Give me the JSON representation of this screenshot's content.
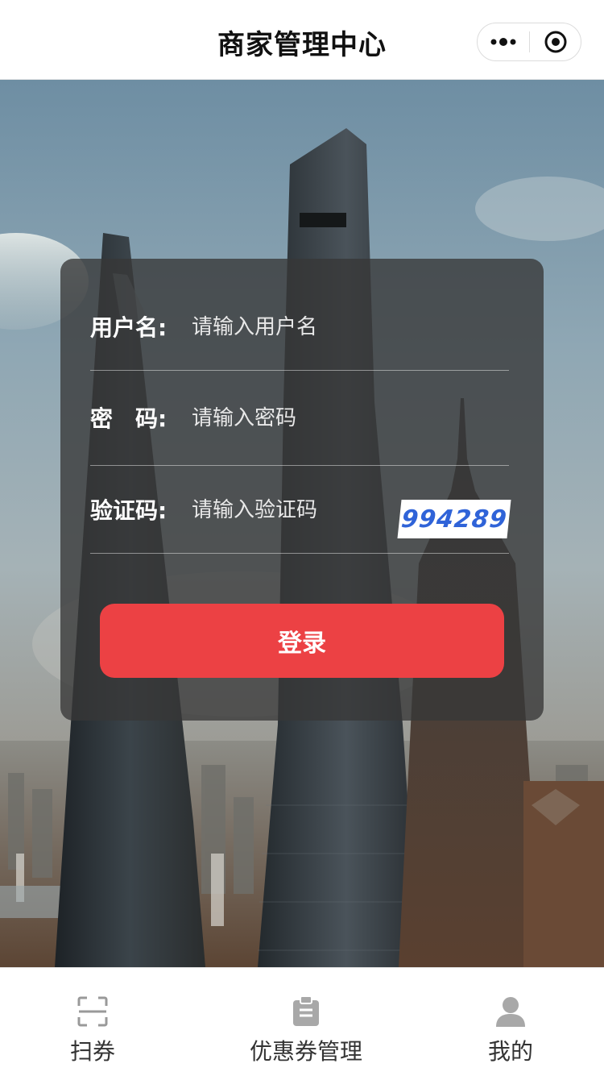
{
  "header": {
    "title": "商家管理中心"
  },
  "form": {
    "username_label": "用户名:",
    "username_placeholder": "请输入用户名",
    "password_label": "密　码:",
    "password_placeholder": "请输入密码",
    "captcha_label": "验证码:",
    "captcha_placeholder": "请输入验证码",
    "captcha_value": "994289",
    "login_label": "登录"
  },
  "tabbar": {
    "items": [
      {
        "label": "扫券",
        "icon": "scan-icon"
      },
      {
        "label": "优惠券管理",
        "icon": "clipboard-icon"
      },
      {
        "label": "我的",
        "icon": "user-icon"
      }
    ]
  },
  "colors": {
    "primary_button": "#ec4144",
    "card_overlay": "rgba(55,55,55,0.78)",
    "captcha_text": "#2f63d8"
  }
}
